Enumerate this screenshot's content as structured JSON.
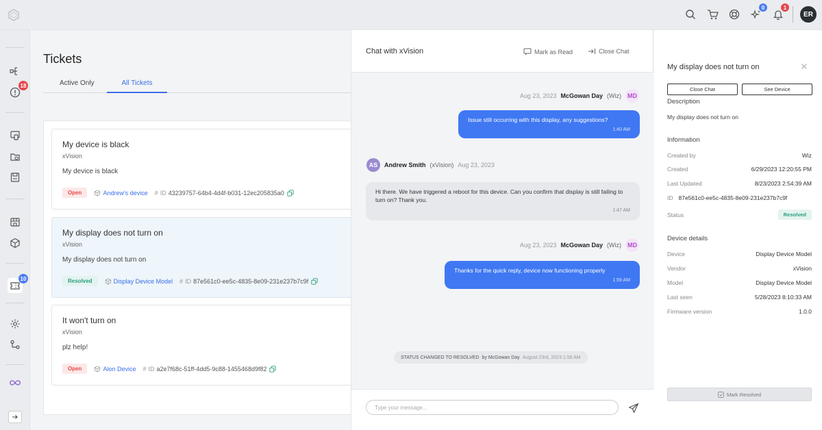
{
  "topbar": {
    "badges": {
      "sparkle": "0",
      "bell": "1"
    },
    "user_initials": "ER"
  },
  "nav": {
    "alerts_badge": "18",
    "tickets_badge": "10"
  },
  "tickets": {
    "title": "Tickets",
    "tabs": [
      {
        "label": "Active Only",
        "active": false
      },
      {
        "label": "All Tickets",
        "active": true
      }
    ],
    "items": [
      {
        "title": "My device is black",
        "vendor": "xVision",
        "description": "My device is black",
        "status": "Open",
        "device": "Andrew's device",
        "id_prefix": "#",
        "id_label": "ID",
        "id": "43239757-64b4-4d4f-b031-12ec205835a0",
        "selected": false
      },
      {
        "title": "My display does not turn on",
        "vendor": "xVision",
        "description": "My display does not turn on",
        "status": "Resolved",
        "device": "Display Device Model",
        "id_prefix": "#",
        "id_label": "ID",
        "id": "87e561c0-ee5c-4835-8e09-231e237b7c9f",
        "selected": true
      },
      {
        "title": "It won't turn on",
        "vendor": "xVision",
        "description": "plz help!",
        "status": "Open",
        "device": "Alon Device",
        "id_prefix": "#",
        "id_label": "ID",
        "id": "a2e7f68c-51ff-4dd5-9c88-1455468d9f82",
        "selected": false
      }
    ]
  },
  "chat": {
    "title": "Chat with xVision",
    "mark_read_label": "Mark as Read",
    "close_chat_label": "Close Chat",
    "messages": [
      {
        "direction": "out",
        "date": "Aug 23, 2023",
        "author": "McGowan Day",
        "role": "(Wiz)",
        "initials": "MD",
        "text": "Issue still occurring with this display, any suggestions?",
        "time": "1:40 AM"
      },
      {
        "direction": "in",
        "date": "Aug 23, 2023",
        "author": "Andrew Smith",
        "role": "(xVision)",
        "initials": "AS",
        "text": "Hi there. We have triggered a reboot for this device. Can you confirm that display is still failing to turn on? Thank you.",
        "time": "1:47 AM"
      },
      {
        "direction": "out",
        "date": "Aug 23, 2023",
        "author": "McGowan Day",
        "role": "(Wiz)",
        "initials": "MD",
        "text": "Thanks for the quick reply, device now functioning properly",
        "time": "1:59 AM"
      }
    ],
    "status_change": {
      "label": "STATUS CHANGED TO RESOLVED",
      "by": "by McGowan Day",
      "date": "August 23rd, 2023 1:59 AM"
    },
    "input_placeholder": "Type your message..."
  },
  "details": {
    "title": "My display does not turn on",
    "close_chat_button": "Close Chat",
    "see_device_button": "See Device",
    "description_heading": "Description",
    "description": "My display does not turn on",
    "information_heading": "Information",
    "info": {
      "created_by_label": "Created by",
      "created_by": "Wiz",
      "created_label": "Created",
      "created": "6/29/2023 12:20:55 PM",
      "last_updated_label": "Last Updated",
      "last_updated": "8/23/2023 2:54:39 AM",
      "id_label": "ID",
      "id": "87e561c0-ee5c-4835-8e09-231e237b7c9f",
      "status_label": "Status",
      "status": "Resolved"
    },
    "device_heading": "Device details",
    "device": {
      "device_label": "Device",
      "device": "Display Device Model",
      "vendor_label": "Vendor",
      "vendor": "xVision",
      "model_label": "Model",
      "model": "Display Device Model",
      "last_seen_label": "Last seen",
      "last_seen": "5/28/2023 8:10:33 AM",
      "firmware_label": "Firmware version",
      "firmware": "1.0.0"
    },
    "mark_resolved_button": "Mark Resolved"
  }
}
